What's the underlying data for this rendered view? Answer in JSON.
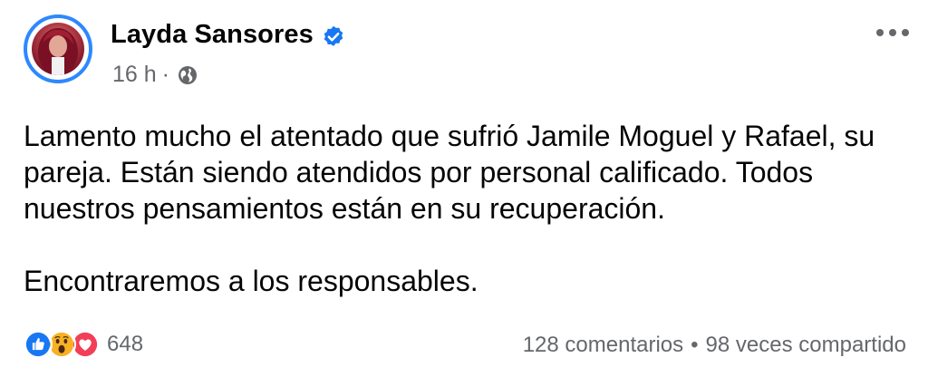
{
  "post": {
    "author": "Layda Sansores",
    "time": "16 h",
    "time_separator": "·",
    "audience_icon": "globe-icon",
    "verified_icon": "verified-badge-icon",
    "more_icon": "more-options-icon",
    "paragraphs": [
      "Lamento mucho el atentado que sufrió Jamile Moguel y Rafael, su pareja. Están siendo atendidos por personal calificado. Todos nuestros pensamientos están en su recuperación.",
      "Encontraremos a los responsables."
    ]
  },
  "footer": {
    "reaction_icons": [
      "like-icon",
      "wow-icon",
      "love-icon"
    ],
    "reaction_count": "648",
    "comments": "128 comentarios",
    "stats_separator": "•",
    "shares": "98 veces compartido"
  },
  "colors": {
    "accent": "#2d88ff",
    "text_primary": "#050505",
    "text_secondary": "#65676b",
    "like": "#1877f2",
    "wow": "#f7b125",
    "love": "#f33e58"
  }
}
